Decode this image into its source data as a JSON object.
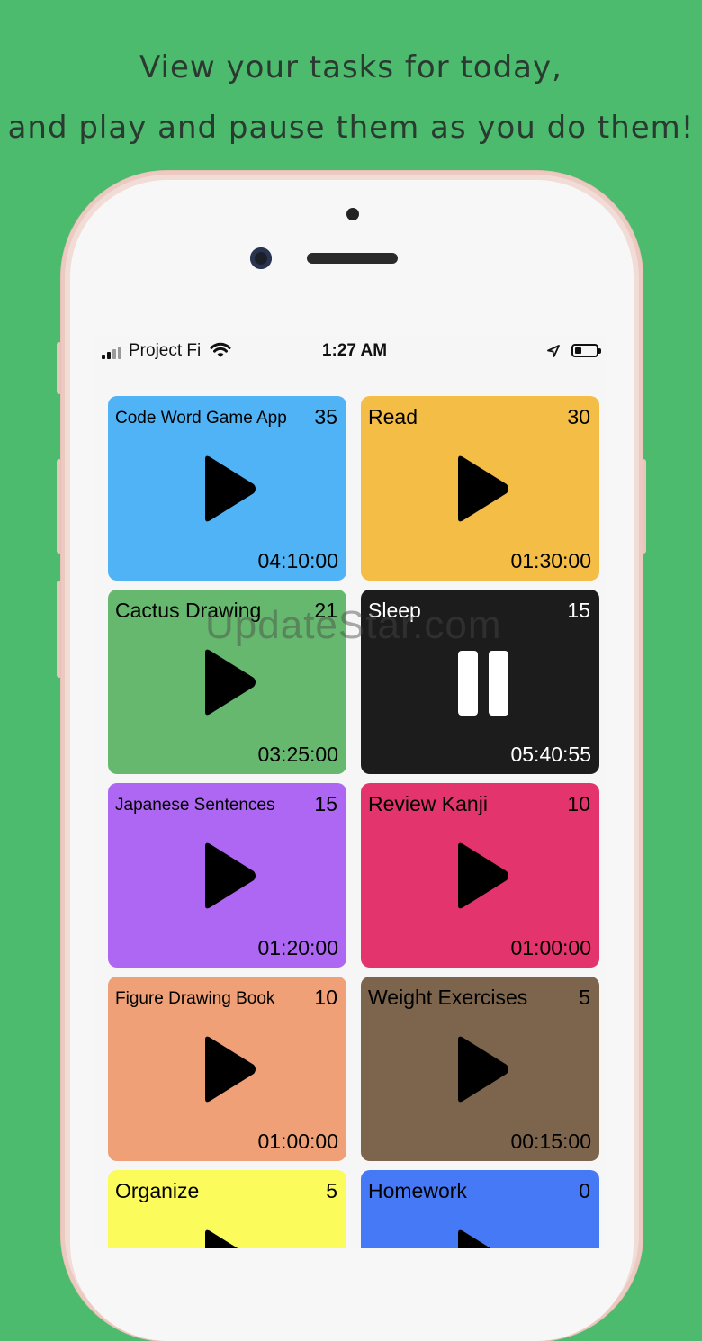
{
  "headline": {
    "line1": "View your tasks for today,",
    "line2": "and play and pause them as you do them!"
  },
  "status_bar": {
    "carrier": "Project Fi",
    "time": "1:27 AM",
    "icons": [
      "signal-icon",
      "wifi-icon",
      "location-arrow-icon",
      "battery-icon"
    ],
    "battery_level": 0.3
  },
  "watermark": "UpdateStar.com",
  "tasks": [
    {
      "name": "Code Word Game App",
      "count": "35",
      "time": "04:10:00",
      "state": "paused",
      "color": "#4fb3f5",
      "icon": "play-icon"
    },
    {
      "name": "Read",
      "count": "30",
      "time": "01:30:00",
      "state": "paused",
      "color": "#f4bd46",
      "icon": "play-icon"
    },
    {
      "name": "Cactus Drawing",
      "count": "21",
      "time": "03:25:00",
      "state": "paused",
      "color": "#66b86e",
      "icon": "play-icon"
    },
    {
      "name": "Sleep",
      "count": "15",
      "time": "05:40:55",
      "state": "running",
      "color": "#1c1c1c",
      "icon": "pause-icon"
    },
    {
      "name": "Japanese Sentences",
      "count": "15",
      "time": "01:20:00",
      "state": "paused",
      "color": "#ae67f3",
      "icon": "play-icon"
    },
    {
      "name": "Review Kanji",
      "count": "10",
      "time": "01:00:00",
      "state": "paused",
      "color": "#e4346d",
      "icon": "play-icon"
    },
    {
      "name": "Figure Drawing Book",
      "count": "10",
      "time": "01:00:00",
      "state": "paused",
      "color": "#efa077",
      "icon": "play-icon"
    },
    {
      "name": "Weight Exercises",
      "count": "5",
      "time": "00:15:00",
      "state": "paused",
      "color": "#7d644d",
      "icon": "play-icon"
    },
    {
      "name": "Organize",
      "count": "5",
      "time": "",
      "state": "paused",
      "color": "#fbfb5b",
      "icon": "play-icon"
    },
    {
      "name": "Homework",
      "count": "0",
      "time": "",
      "state": "paused",
      "color": "#4679f5",
      "icon": "play-icon"
    }
  ]
}
